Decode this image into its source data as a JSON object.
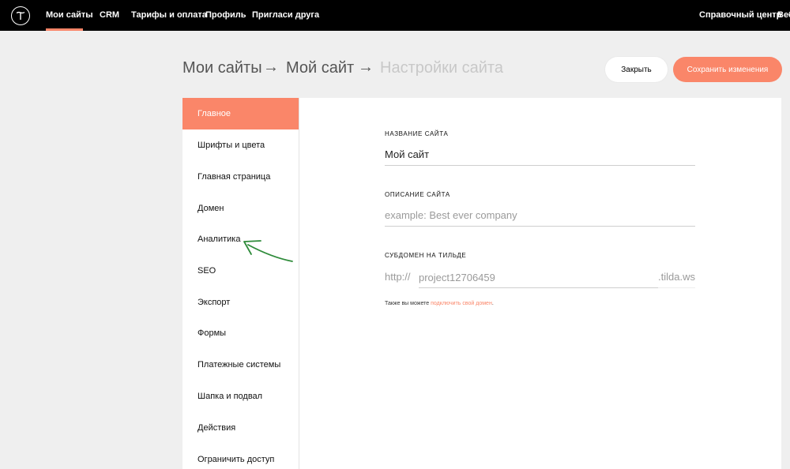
{
  "nav": {
    "items": [
      {
        "label": "Мои сайты",
        "active": true
      },
      {
        "label": "CRM"
      },
      {
        "label": "Тарифы и оплата"
      },
      {
        "label": "Профиль"
      },
      {
        "label": "Пригласи друга"
      }
    ],
    "right_items": [
      {
        "label": "Справочный центр"
      },
      {
        "label": "Веб"
      }
    ]
  },
  "breadcrumb": {
    "items": [
      "Мои сайты",
      "Мой сайт",
      "Настройки сайта"
    ],
    "separator": "→"
  },
  "actions": {
    "close_label": "Закрыть",
    "save_label": "Сохранить изменения"
  },
  "sidebar": {
    "items": [
      {
        "label": "Главное",
        "active": true
      },
      {
        "label": "Шрифты и цвета"
      },
      {
        "label": "Главная страница"
      },
      {
        "label": "Домен"
      },
      {
        "label": "Аналитика"
      },
      {
        "label": "SEO"
      },
      {
        "label": "Экспорт"
      },
      {
        "label": "Формы"
      },
      {
        "label": "Платежные системы"
      },
      {
        "label": "Шапка и подвал"
      },
      {
        "label": "Действия"
      },
      {
        "label": "Ограничить доступ"
      }
    ]
  },
  "form": {
    "site_name": {
      "label": "НАЗВАНИЕ САЙТА",
      "value": "Мой сайт"
    },
    "site_description": {
      "label": "ОПИСАНИЕ САЙТА",
      "value": "",
      "placeholder": "example: Best ever company"
    },
    "subdomain": {
      "label": "СУБДОМЕН НА ТИЛЬДЕ",
      "prefix": "http://",
      "value": "project12706459",
      "suffix": ".tilda.ws"
    },
    "hint_text": "Также вы можете ",
    "hint_link": "подключить свой домен",
    "hint_end": "."
  },
  "colors": {
    "accent": "#fa8669",
    "topbar": "#000000",
    "annotation": "#2e8b3a"
  },
  "icons": {
    "logo": "tilda-logo-icon",
    "annotation": "green-arrow-annotation"
  }
}
